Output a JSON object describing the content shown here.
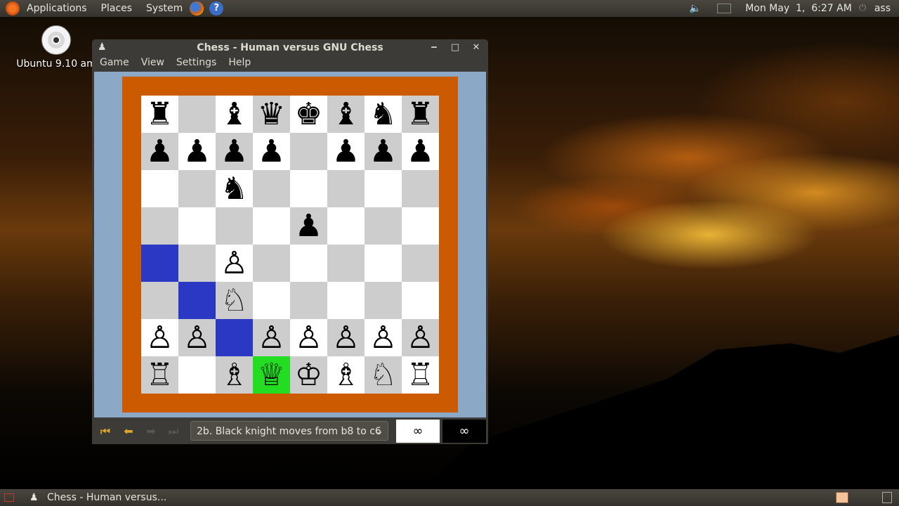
{
  "top_panel": {
    "menus": [
      "Applications",
      "Places",
      "System"
    ],
    "datetime": "Mon May  1,  6:27 AM",
    "user": "ass",
    "icons": [
      "ubuntu-logo-icon",
      "firefox-icon",
      "help-icon",
      "volume-icon",
      "mail-icon",
      "power-icon"
    ]
  },
  "desktop": {
    "icon_label": "Ubuntu 9.10 am"
  },
  "window": {
    "title": "Chess - Human versus GNU Chess",
    "menus": [
      "Game",
      "View",
      "Settings",
      "Help"
    ],
    "controls": {
      "move_history_selected": "2b. Black knight moves from b8 to c6",
      "white_clock": "∞",
      "black_clock": "∞"
    }
  },
  "board": {
    "colors": {
      "frame": "#cc5a00",
      "move_highlight": "#2b38c4",
      "selected": "#22dd22"
    },
    "ranks": [
      [
        "♜",
        "",
        "♝",
        "♛",
        "♚",
        "♝",
        "♞",
        "♜"
      ],
      [
        "♟",
        "♟",
        "♟",
        "♟",
        "",
        "♟",
        "♟",
        "♟"
      ],
      [
        "",
        "",
        "♞",
        "",
        "",
        "",
        "",
        ""
      ],
      [
        "",
        "",
        "",
        "",
        "♟",
        "",
        "",
        ""
      ],
      [
        "",
        "",
        "♙",
        "",
        "",
        "",
        "",
        ""
      ],
      [
        "",
        "",
        "♘",
        "",
        "",
        "",
        "",
        ""
      ],
      [
        "♙",
        "♙",
        "",
        "♙",
        "♙",
        "♙",
        "♙",
        "♙"
      ],
      [
        "♖",
        "",
        "♗",
        "♕",
        "♔",
        "♗",
        "♘",
        "♖"
      ]
    ],
    "move_squares": [
      [
        4,
        0
      ],
      [
        5,
        1
      ],
      [
        6,
        2
      ]
    ],
    "selected_square": [
      7,
      3
    ]
  },
  "bottom_panel": {
    "task": "Chess - Human versus..."
  }
}
